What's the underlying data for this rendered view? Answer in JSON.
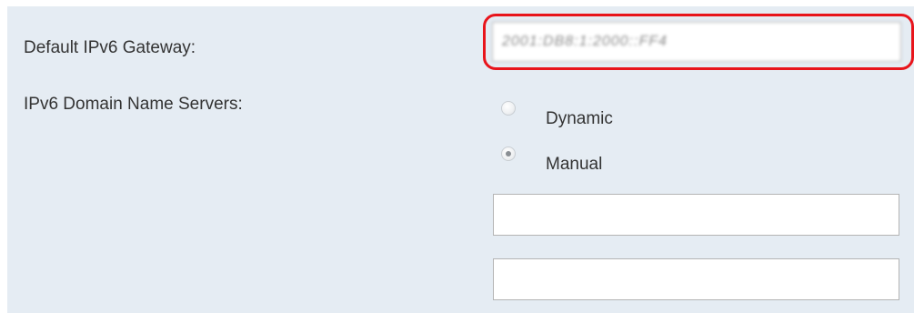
{
  "form": {
    "gateway_label": "Default IPv6 Gateway:",
    "gateway_value": "2001:DB8:1:2000::FF4",
    "dns_label": "IPv6 Domain Name Servers:",
    "dns_options": [
      {
        "label": "Dynamic",
        "checked": false
      },
      {
        "label": "Manual",
        "checked": true
      }
    ],
    "dns_server_1": "",
    "dns_server_2": ""
  },
  "colors": {
    "panel_background": "#e5ecf3",
    "highlight_border": "#e8141b",
    "label_text": "#333333"
  }
}
